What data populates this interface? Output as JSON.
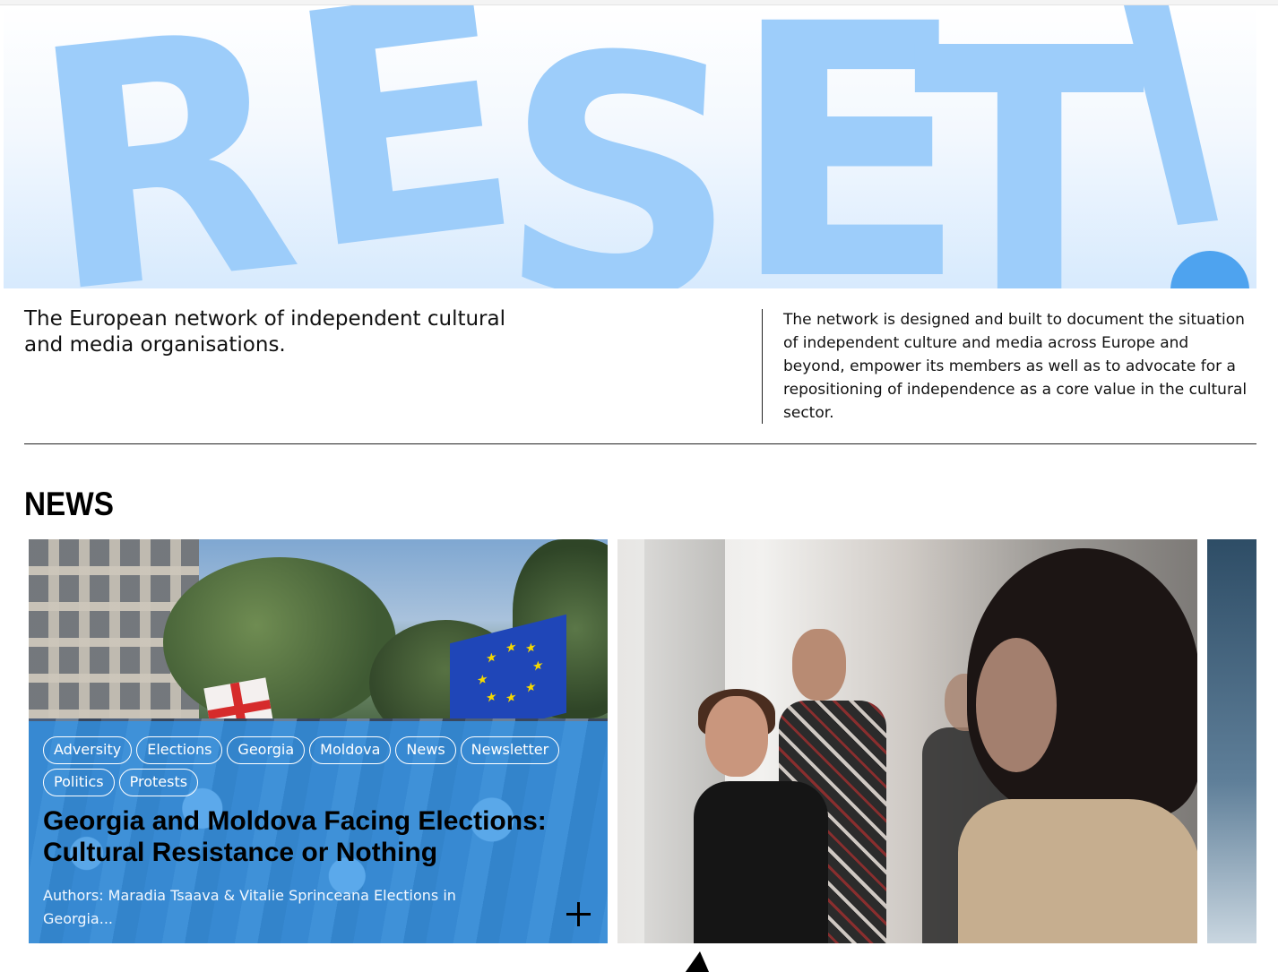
{
  "hero": {
    "logo_text": "RESET!",
    "logo_color": "#9dcdfa"
  },
  "intro": {
    "tagline": "The European network of independent cultural and media organisations.",
    "description": "The network is designed and built to document the situation of independent culture and media across Europe and beyond, empower its members as well as to advocate for a repositioning of independence as a core value in the cultural sector."
  },
  "news": {
    "heading": "NEWS",
    "cards": [
      {
        "tags": [
          "Adversity",
          "Elections",
          "Georgia",
          "Moldova",
          "News",
          "Newsletter",
          "Politics",
          "Protests"
        ],
        "title": "Georgia and Moldova Facing Elections: Cultural Resistance or Nothing",
        "excerpt": "Authors: Maradia Tsaava & Vitalie Sprinceana   Elections in Georgia...",
        "expand_icon": "plus-icon",
        "overlay_color": "#3296eb"
      },
      {
        "image": "people-at-event-photo"
      },
      {
        "image": "partial-card-photo"
      }
    ]
  },
  "cursor": {
    "icon": "pointer-cursor-icon"
  }
}
